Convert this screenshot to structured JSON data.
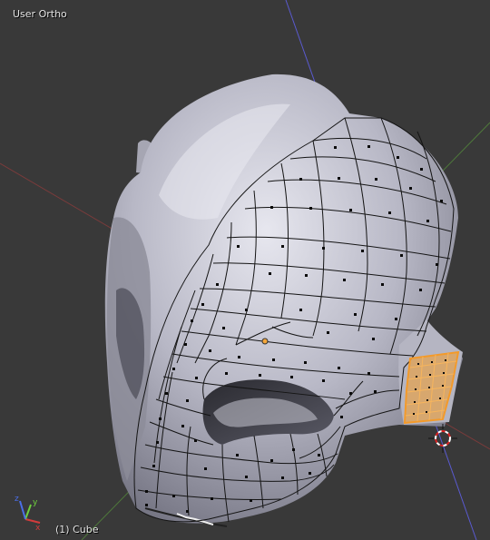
{
  "viewport": {
    "view_name": "User Ortho",
    "object_name": "(1) Cube"
  },
  "axes_gizmo": {
    "x_label": "x",
    "y_label": "y",
    "z_label": "z",
    "x_color": "#d33b3b",
    "y_color": "#6fd03f",
    "z_color": "#4b6fe8"
  },
  "colors": {
    "background": "#393939",
    "mesh_surface": "#b9b9c6",
    "wire": "#141414",
    "selection": "#f39a2a",
    "x_axis_line": "#7a3b3b",
    "y_axis_line": "#4f7a3b",
    "z_axis_line": "#5a5ad0"
  }
}
